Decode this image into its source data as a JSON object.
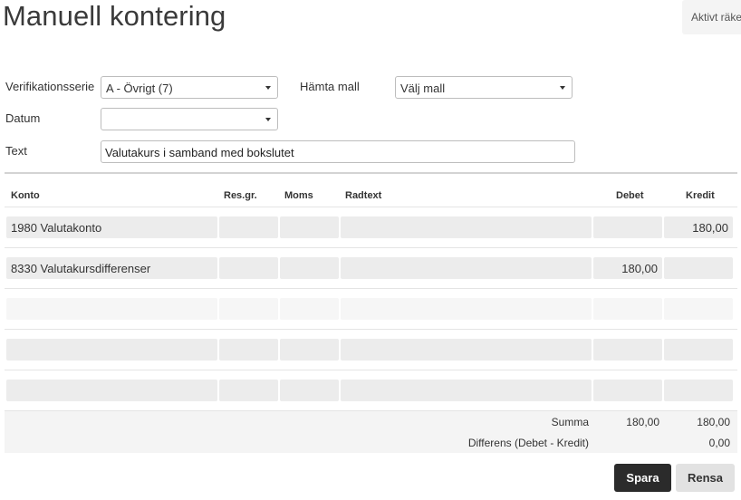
{
  "page": {
    "title": "Manuell kontering"
  },
  "account_box": {
    "label": "Aktivt räkenskapsår"
  },
  "form": {
    "series_label": "Verifikationsserie",
    "series_value": "A - Övrigt (7)",
    "template_label": "Hämta mall",
    "template_value": "Välj mall",
    "date_label": "Datum",
    "date_value": "",
    "text_label": "Text",
    "text_value": "Valutakurs i samband med bokslutet"
  },
  "table": {
    "headers": {
      "konto": "Konto",
      "resgr": "Res.gr.",
      "moms": "Moms",
      "radtext": "Radtext",
      "debet": "Debet",
      "kredit": "Kredit"
    },
    "rows": [
      {
        "konto": "1980 Valutakonto",
        "resgr": "",
        "moms": "",
        "radtext": "",
        "debet": "",
        "kredit": "180,00"
      },
      {
        "konto": "8330 Valutakursdifferenser",
        "resgr": "",
        "moms": "",
        "radtext": "",
        "debet": "180,00",
        "kredit": ""
      },
      {
        "konto": "",
        "resgr": "",
        "moms": "",
        "radtext": "",
        "debet": "",
        "kredit": ""
      },
      {
        "konto": "",
        "resgr": "",
        "moms": "",
        "radtext": "",
        "debet": "",
        "kredit": ""
      },
      {
        "konto": "",
        "resgr": "",
        "moms": "",
        "radtext": "",
        "debet": "",
        "kredit": ""
      }
    ]
  },
  "summary": {
    "summa_label": "Summa",
    "summa_debet": "180,00",
    "summa_kredit": "180,00",
    "diff_label": "Differens (Debet - Kredit)",
    "diff_value": "0,00"
  },
  "buttons": {
    "save": "Spara",
    "clear": "Rensa"
  }
}
